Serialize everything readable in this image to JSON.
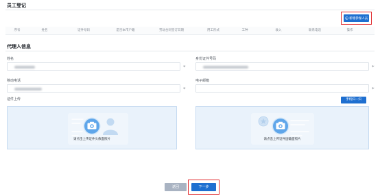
{
  "employee": {
    "title": "员工登记",
    "add_button_label": "新增参保人员",
    "table_headers": [
      "序号",
      "姓名",
      "证件号码",
      "是否本市户籍",
      "劳动合同签订日期",
      "用工形式",
      "工种",
      "收入",
      "联系电话",
      "操作"
    ]
  },
  "agent": {
    "title": "代理人信息",
    "fields": {
      "name": {
        "label": "姓名"
      },
      "id_number": {
        "label": "身份证件号码"
      },
      "mobile": {
        "label": "移动电话"
      },
      "email": {
        "label": "电子邮箱"
      }
    },
    "required_mark": "*",
    "upload_label": "证件上传",
    "scan_button_label": "手机扫一扫",
    "upload_front_text": "请点击上传证件头像面照片",
    "upload_back_text": "请点击上传证件国徽面照片"
  },
  "footer": {
    "back_label": "返回",
    "next_label": "下一步"
  },
  "colors": {
    "primary": "#1e6fd0",
    "highlight": "#e0262a",
    "secondary_button": "#a9b3c2",
    "upload_bg": "#e9f2fb"
  },
  "icons": {
    "add": "plus-circle-icon",
    "camera": "camera-icon",
    "id_front": "person-silhouette-icon",
    "id_back": "national-emblem-icon"
  }
}
